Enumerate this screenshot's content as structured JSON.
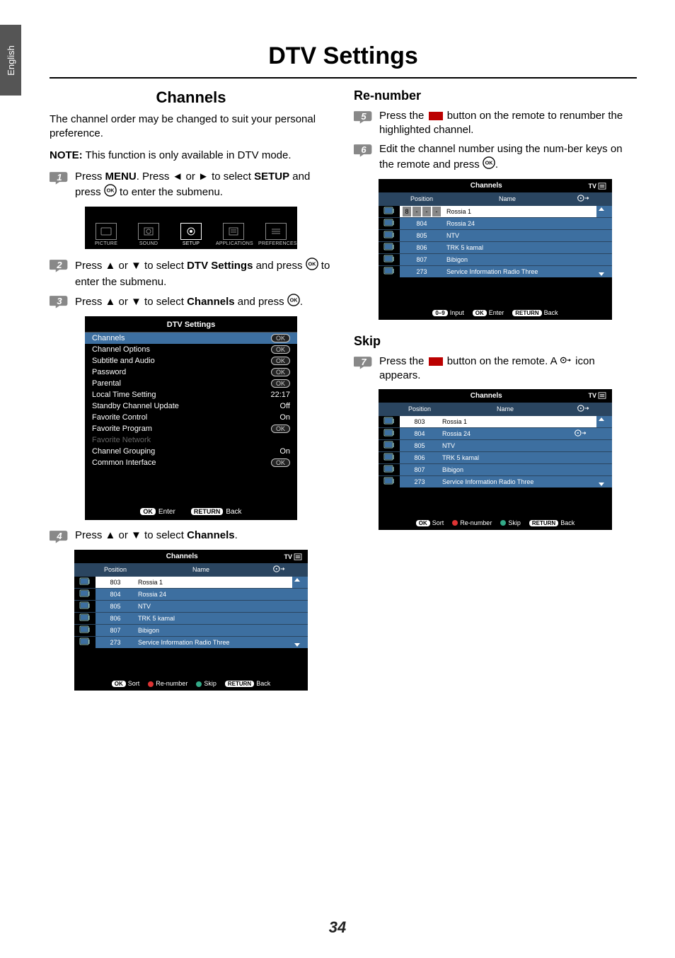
{
  "lang_tab": "English",
  "page_title": "DTV Settings",
  "page_number": "34",
  "left": {
    "heading": "Channels",
    "intro": "The channel order may be changed to suit your personal preference.",
    "note_label": "NOTE:",
    "note_text": " This function is only available in DTV mode.",
    "step1_a": "Press ",
    "step1_menu": "MENU",
    "step1_b": ". Press ◄ or ► to select ",
    "step1_setup": "SETUP",
    "step1_c": " and press ",
    "step1_d": " to enter  the submenu.",
    "menu_items": [
      "PICTURE",
      "SOUND",
      "SETUP",
      "APPLICATIONS",
      "PREFERENCES"
    ],
    "step2_a": "Press ▲ or ▼ to select ",
    "step2_b": "DTV Settings",
    "step2_c": " and press ",
    "step2_d": " to enter the submenu.",
    "step3_a": "Press ▲ or ▼ to select ",
    "step3_b": "Channels",
    "step3_c": " and press ",
    "step3_d": ".",
    "step4_a": "Press ▲ or ▼ to select ",
    "step4_b": "Channels",
    "step4_c": ".",
    "dtv": {
      "title": "DTV Settings",
      "rows": [
        {
          "label": "Channels",
          "val": "OK",
          "sel": true,
          "btn": true
        },
        {
          "label": "Channel Options",
          "val": "OK",
          "btn": true
        },
        {
          "label": "Subtitle and Audio",
          "val": "OK",
          "btn": true
        },
        {
          "label": "Password",
          "val": "OK",
          "btn": true
        },
        {
          "label": "Parental",
          "val": "OK",
          "btn": true
        },
        {
          "label": "Local Time Setting",
          "val": "22:17"
        },
        {
          "label": "Standby Channel Update",
          "val": "Off"
        },
        {
          "label": "Favorite Control",
          "val": "On"
        },
        {
          "label": "Favorite Program",
          "val": "OK",
          "btn": true
        },
        {
          "label": "Favorite Network",
          "val": "",
          "dim": true
        },
        {
          "label": "Channel Grouping",
          "val": "On"
        },
        {
          "label": "Common Interface",
          "val": "OK",
          "btn": true
        }
      ],
      "footer_ok": "OK",
      "footer_enter": "Enter",
      "footer_return": "RETURN",
      "footer_back": "Back"
    }
  },
  "right": {
    "renumber_heading": "Re-number",
    "step5_a": "Press the ",
    "step5_b": " button on the remote to renumber the highlighted channel.",
    "step6_a": "Edit the channel number using the num-ber keys on the remote and press ",
    "step6_b": ".",
    "skip_heading": "Skip",
    "step7_a": "Press the ",
    "step7_b": " button on the remote. A ",
    "step7_c": " icon appears."
  },
  "ch_panel": {
    "title": "Channels",
    "tv": "TV",
    "hdr_position": "Position",
    "hdr_name": "Name",
    "rows": [
      {
        "pos": "803",
        "name": "Rossia 1"
      },
      {
        "pos": "804",
        "name": "Rossia 24"
      },
      {
        "pos": "805",
        "name": "NTV"
      },
      {
        "pos": "806",
        "name": "TRK 5 kamal"
      },
      {
        "pos": "807",
        "name": "Bibigon"
      },
      {
        "pos": "273",
        "name": "Service Information Radio Three"
      }
    ],
    "footer": {
      "ok": "OK",
      "sort": "Sort",
      "renumber": "Re-number",
      "skip": "Skip",
      "return": "RETURN",
      "back": "Back",
      "num": "0–9",
      "input": "Input",
      "enter": "Enter"
    }
  },
  "chart_data": null
}
